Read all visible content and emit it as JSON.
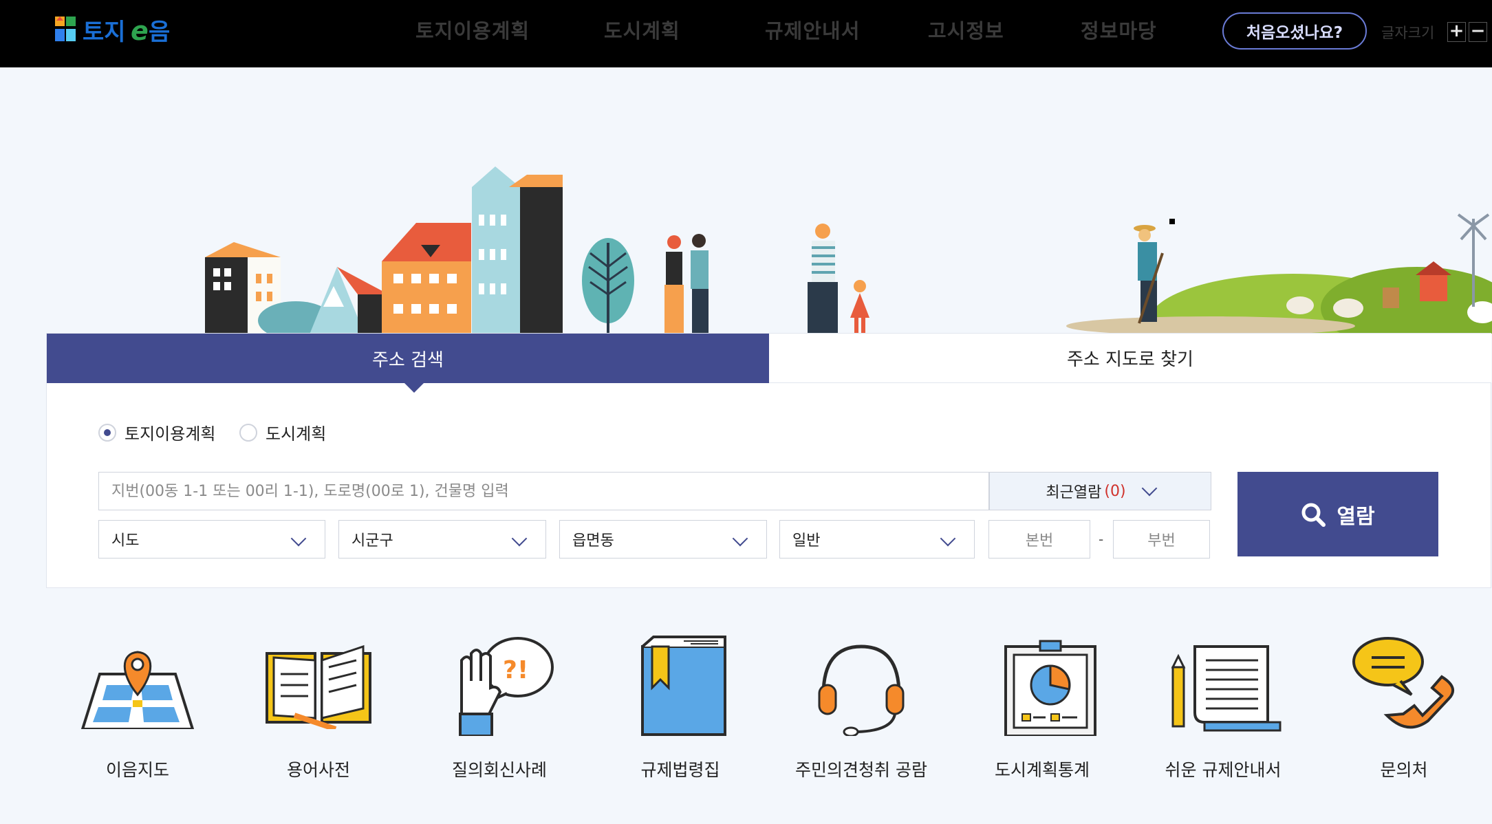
{
  "header": {
    "logo_text": "토지e음",
    "nav": [
      "토지이용계획",
      "도시계획",
      "규제안내서",
      "고시정보",
      "정보마당"
    ],
    "first_visit_label": "처음오셨나요?",
    "font_size_label": "글자크기",
    "font_increase": "+",
    "font_decrease": "−"
  },
  "search": {
    "tabs": [
      "주소 검색",
      "주소 지도로 찾기"
    ],
    "radios": [
      {
        "label": "토지이용계획",
        "checked": true
      },
      {
        "label": "도시계획",
        "checked": false
      }
    ],
    "input_placeholder": "지번(00동 1-1 또는 00리 1-1), 도로명(00로 1), 건물명 입력",
    "recent_label": "최근열람",
    "recent_count": "(0)",
    "selects": [
      "시도",
      "시군구",
      "읍면동",
      "일반"
    ],
    "main_number_placeholder": "본번",
    "dash": "-",
    "sub_number_placeholder": "부번",
    "view_button": "열람"
  },
  "quick_links": [
    {
      "label": "이음지도",
      "icon": "map-pin-icon"
    },
    {
      "label": "용어사전",
      "icon": "open-book-icon"
    },
    {
      "label": "질의회신사례",
      "icon": "question-hand-icon"
    },
    {
      "label": "규제법령집",
      "icon": "law-book-icon"
    },
    {
      "label": "주민의견청취 공람",
      "icon": "headset-icon"
    },
    {
      "label": "도시계획통계",
      "icon": "pie-chart-board-icon"
    },
    {
      "label": "쉬운 규제안내서",
      "icon": "document-scroll-icon"
    },
    {
      "label": "문의처",
      "icon": "phone-chat-icon"
    }
  ],
  "colors": {
    "primary": "#424b8f",
    "header_bg": "#000000",
    "accent_red": "#d0322c"
  }
}
